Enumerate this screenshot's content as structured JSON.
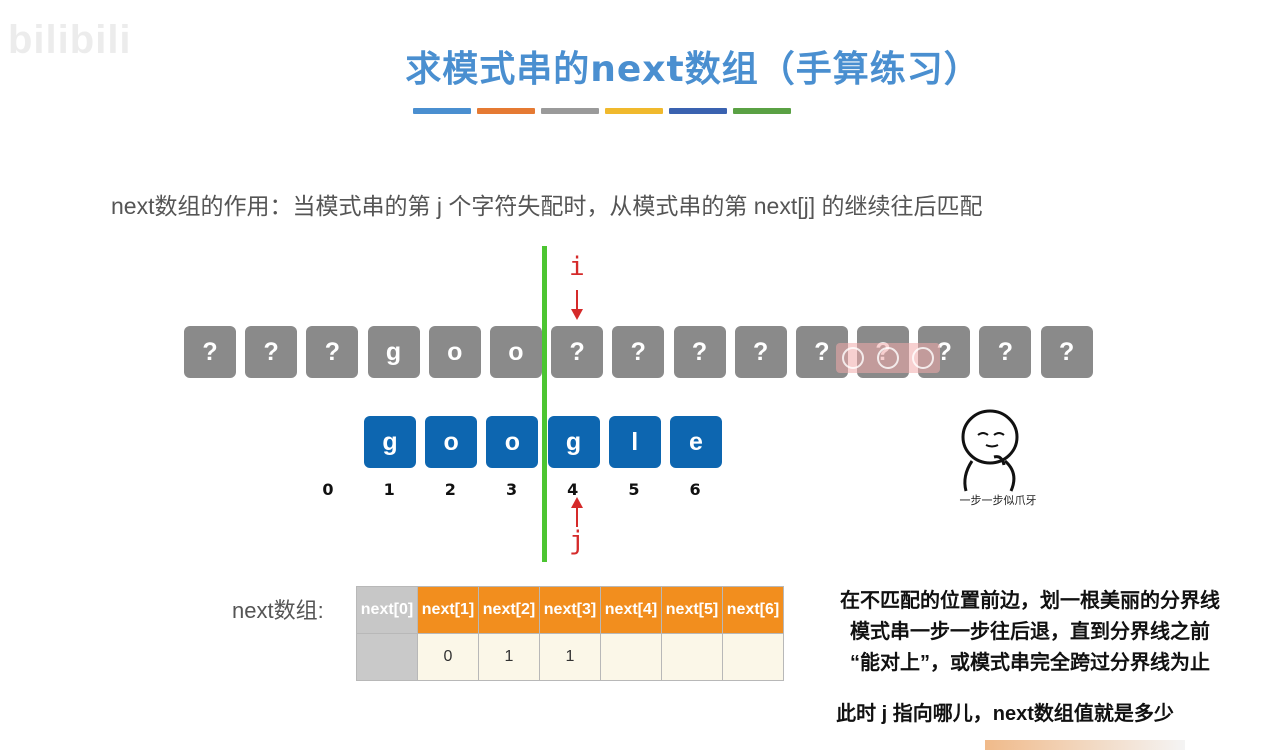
{
  "watermark": "bilibili",
  "title": "求模式串的next数组（手算练习）",
  "stripe_colors": [
    "#4a8fd0",
    "#e57a33",
    "#9a9a9a",
    "#f0b92d",
    "#3a62b0",
    "#5aa144"
  ],
  "subtitle": "next数组的作用：当模式串的第 j 个字符失配时，从模式串的第 next[j] 的继续往后匹配",
  "main_string": [
    "?",
    "?",
    "?",
    "g",
    "o",
    "o",
    "?",
    "?",
    "?",
    "?",
    "?",
    "?",
    "?",
    "?",
    "?"
  ],
  "pattern": [
    "g",
    "o",
    "o",
    "g",
    "l",
    "e"
  ],
  "indices": [
    "0",
    "1",
    "2",
    "3",
    "4",
    "5",
    "6"
  ],
  "pointer_i": "i",
  "pointer_j": "j",
  "next_label": "next数组:",
  "next_headers": [
    "next[0]",
    "next[1]",
    "next[2]",
    "next[3]",
    "next[4]",
    "next[5]",
    "next[6]"
  ],
  "next_values": [
    "",
    "0",
    "1",
    "1",
    "",
    "",
    ""
  ],
  "notes": {
    "line1": "在不匹配的位置前边，划一根美丽的分界线",
    "line2": "模式串一步一步往后退，直到分界线之前",
    "line3": "“能对上”，或模式串完全跨过分界线为止",
    "line4": "此时 j 指向哪儿，next数组值就是多少"
  },
  "sticker_caption": "一步一步似爪牙",
  "colors": {
    "title": "#4a8fd0",
    "gray_cell": "#8a8a8a",
    "blue_cell": "#0d66b0",
    "divider": "#4cc531",
    "pointer": "#d52a2a",
    "header_orange": "#f28e1e"
  }
}
